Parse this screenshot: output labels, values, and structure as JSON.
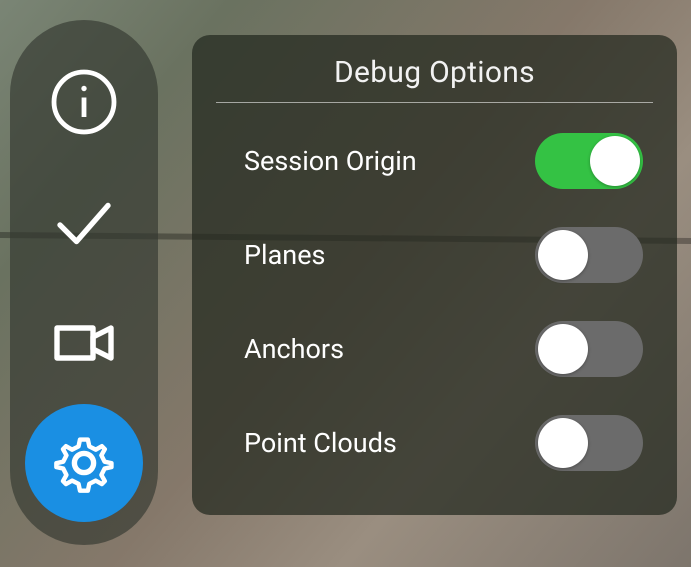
{
  "panel": {
    "title": "Debug Options",
    "rows": [
      {
        "label": "Session Origin",
        "enabled": true
      },
      {
        "label": "Planes",
        "enabled": false
      },
      {
        "label": "Anchors",
        "enabled": false
      },
      {
        "label": "Point Clouds",
        "enabled": false
      }
    ]
  },
  "sidebar": {
    "items": [
      {
        "name": "info",
        "icon": "info-icon",
        "active": false
      },
      {
        "name": "check",
        "icon": "check-icon",
        "active": false
      },
      {
        "name": "camera",
        "icon": "camera-icon",
        "active": false
      },
      {
        "name": "settings",
        "icon": "gear-icon",
        "active": true
      }
    ]
  },
  "colors": {
    "toggle_on": "#34c244",
    "toggle_off": "#6b6b6b",
    "accent": "#1a8fe3"
  }
}
